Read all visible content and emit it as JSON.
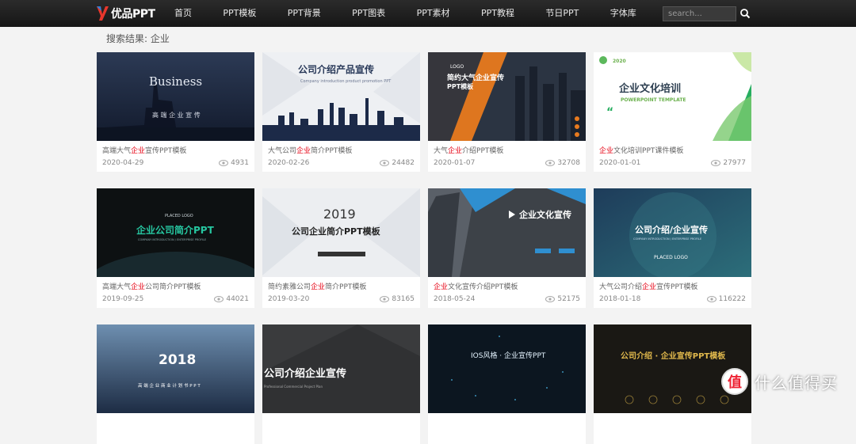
{
  "header": {
    "logo_text": "优品PPT",
    "nav": [
      "首页",
      "PPT模板",
      "PPT背景",
      "PPT图表",
      "PPT素材",
      "PPT教程",
      "节日PPT",
      "字体库"
    ],
    "search_placeholder": "search..."
  },
  "result": {
    "label": "搜索结果:",
    "keyword": "企业"
  },
  "cards": [
    {
      "title_pre": "高端大气",
      "title_hl": "企业",
      "title_post": "宣传PPT模板",
      "date": "2020-04-29",
      "views": "4931",
      "thumb": {
        "t1": "Business",
        "t2": "高 端 企 业 宣 传"
      }
    },
    {
      "title_pre": "大气公司",
      "title_hl": "企业",
      "title_post": "简介PPT模板",
      "date": "2020-02-26",
      "views": "24482",
      "thumb": {
        "t1": "公司介绍产品宣传",
        "t2": "Company introduction product promotion PPT"
      }
    },
    {
      "title_pre": "大气",
      "title_hl": "企业",
      "title_post": "介绍PPT模板",
      "date": "2020-01-07",
      "views": "32708",
      "thumb": {
        "t1": "LOGO",
        "t2": "简约大气企业宣传",
        "t3": "PPT模板"
      }
    },
    {
      "title_pre": "",
      "title_hl": "企业",
      "title_post": "文化培训PPT课件模板",
      "date": "2020-01-01",
      "views": "27977",
      "thumb": {
        "t1": "2020",
        "t2": "企业文化培训",
        "t3": "POWERPOINT TEMPLATE"
      }
    },
    {
      "title_pre": "高端大气",
      "title_hl": "企业",
      "title_post": "公司简介PPT模板",
      "date": "2019-09-25",
      "views": "44021",
      "thumb": {
        "t1": "PLACED LOGO",
        "t2": "企业公司简介PPT",
        "t3": "COMPANY INTRODUCTION / ENTERPRISE PROFILE"
      }
    },
    {
      "title_pre": "简约素雅公司",
      "title_hl": "企业",
      "title_post": "简介PPT模板",
      "date": "2019-03-20",
      "views": "83165",
      "thumb": {
        "t1": "2019",
        "t2": "公司企业简介PPT模板"
      }
    },
    {
      "title_pre": "",
      "title_hl": "企业",
      "title_post": "文化宣传介绍PPT模板",
      "date": "2018-05-24",
      "views": "52175",
      "thumb": {
        "t1": "企业文化宣传"
      }
    },
    {
      "title_pre": "大气公司介绍",
      "title_hl": "企业",
      "title_post": "宣传PPT模板",
      "date": "2018-01-18",
      "views": "116222",
      "thumb": {
        "t1": "公司介绍/企业宣传",
        "t2": "COMPANY INTRODUCTION / ENTERPRISE PROFILE",
        "t3": "PLACED LOGO"
      }
    },
    {
      "thumb": {
        "t1": "2018",
        "t2": "高 端 企 业 商 业 计 划 书 P P T"
      }
    },
    {
      "thumb": {
        "t1": "公司介绍企业宣传",
        "t2": "Professional Commercial Project Plan"
      }
    },
    {
      "thumb": {
        "t1": "IOS风格 · 企业宣传PPT"
      }
    },
    {
      "thumb": {
        "t1": "公司介绍 · 企业宣传PPT模板"
      }
    }
  ],
  "watermark": {
    "icon_text": "值",
    "text": "什么值得买"
  },
  "colors": {
    "highlight": "#e60012",
    "topbar": "#1e1e1e",
    "background": "#f3f3f3"
  }
}
